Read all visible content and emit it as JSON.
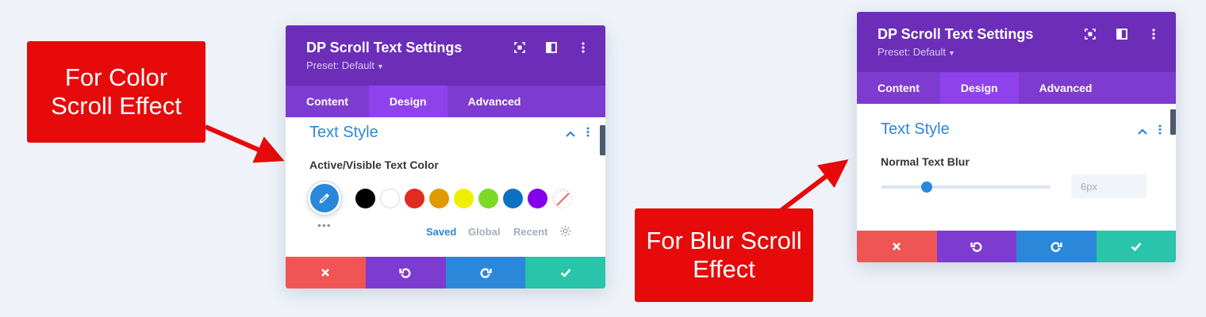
{
  "callouts": {
    "color": {
      "line1": "For Color",
      "line2": "Scroll Effect"
    },
    "blur": {
      "line1": "For Blur Scroll",
      "line2": "Effect"
    }
  },
  "colors": {
    "header": "#6c2eb9",
    "tabs_bg": "#7e3bd0",
    "tab_active": "#8f42ec",
    "accent": "#2b87da",
    "callout": "#e60a0a",
    "cancel": "#ef5555",
    "undo": "#7d3bcf",
    "redo": "#2b87da",
    "save": "#29c4a9"
  },
  "panel_color": {
    "title": "DP Scroll Text Settings",
    "preset": "Preset: Default",
    "header_icons": [
      "expand-icon",
      "split-view-icon",
      "more-vertical-icon"
    ],
    "tabs": [
      {
        "label": "Content",
        "active": false
      },
      {
        "label": "Design",
        "active": true
      },
      {
        "label": "Advanced",
        "active": false
      }
    ],
    "section_title": "Text Style",
    "field_label": "Active/Visible Text Color",
    "swatches": [
      "#000000",
      "#ffffff",
      "#e02b20",
      "#e09900",
      "#edf000",
      "#7cda24",
      "#0c71c3",
      "#8300e9"
    ],
    "color_tabs": [
      {
        "label": "Saved",
        "active": true
      },
      {
        "label": "Global",
        "active": false
      },
      {
        "label": "Recent",
        "active": false
      }
    ],
    "footer_icons": [
      "close-icon",
      "undo-icon",
      "redo-icon",
      "check-icon"
    ]
  },
  "panel_blur": {
    "title": "DP Scroll Text Settings",
    "preset": "Preset: Default",
    "header_icons": [
      "expand-icon",
      "split-view-icon",
      "more-vertical-icon"
    ],
    "tabs": [
      {
        "label": "Content",
        "active": false
      },
      {
        "label": "Design",
        "active": true
      },
      {
        "label": "Advanced",
        "active": false
      }
    ],
    "section_title": "Text Style",
    "field_label": "Normal Text Blur",
    "slider_value": "6px",
    "slider_fraction": 0.27,
    "footer_icons": [
      "close-icon",
      "undo-icon",
      "redo-icon",
      "check-icon"
    ]
  }
}
